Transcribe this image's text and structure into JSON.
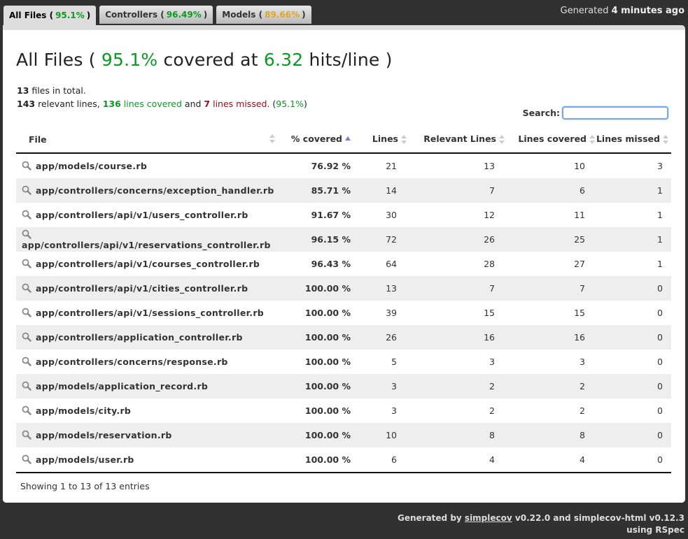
{
  "tabs": [
    {
      "label": "All Files",
      "pct": "95.1%",
      "color": "green",
      "active": true
    },
    {
      "label": "Controllers",
      "pct": "96.49%",
      "color": "green",
      "active": false
    },
    {
      "label": "Models",
      "pct": "89.66%",
      "color": "yellow",
      "active": false
    }
  ],
  "timestamp": {
    "prefix": "Generated",
    "value": "4 minutes ago"
  },
  "title": {
    "name": "All Files",
    "covered_pct": "95.1%",
    "covered_text": "covered at",
    "hits": "6.32",
    "hits_text": "hits/line"
  },
  "summary": {
    "files_count": "13",
    "files_text": "files in total.",
    "relevant": "143",
    "relevant_text": "relevant lines,",
    "covered": "136",
    "covered_text": "lines covered",
    "and_text": "and",
    "missed": "7",
    "missed_text": "lines missed.",
    "pct": "95.1%"
  },
  "search": {
    "label": "Search:",
    "value": "",
    "placeholder": ""
  },
  "table": {
    "headers": {
      "file": "File",
      "covered": "% covered",
      "lines": "Lines",
      "relevant": "Relevant Lines",
      "lines_covered": "Lines covered",
      "missed": "Lines missed"
    },
    "rows": [
      {
        "file": "app/models/course.rb",
        "covered": "76.92 %",
        "level": "red",
        "lines": "21",
        "relevant": "13",
        "lines_covered": "10",
        "missed": "3"
      },
      {
        "file": "app/controllers/concerns/exception_handler.rb",
        "covered": "85.71 %",
        "level": "yellow",
        "lines": "14",
        "relevant": "7",
        "lines_covered": "6",
        "missed": "1"
      },
      {
        "file": "app/controllers/api/v1/users_controller.rb",
        "covered": "91.67 %",
        "level": "green",
        "lines": "30",
        "relevant": "12",
        "lines_covered": "11",
        "missed": "1"
      },
      {
        "file": "app/controllers/api/v1/reservations_controller.rb",
        "covered": "96.15 %",
        "level": "green",
        "lines": "72",
        "relevant": "26",
        "lines_covered": "25",
        "missed": "1"
      },
      {
        "file": "app/controllers/api/v1/courses_controller.rb",
        "covered": "96.43 %",
        "level": "green",
        "lines": "64",
        "relevant": "28",
        "lines_covered": "27",
        "missed": "1"
      },
      {
        "file": "app/controllers/api/v1/cities_controller.rb",
        "covered": "100.00 %",
        "level": "green",
        "lines": "13",
        "relevant": "7",
        "lines_covered": "7",
        "missed": "0"
      },
      {
        "file": "app/controllers/api/v1/sessions_controller.rb",
        "covered": "100.00 %",
        "level": "green",
        "lines": "39",
        "relevant": "15",
        "lines_covered": "15",
        "missed": "0"
      },
      {
        "file": "app/controllers/application_controller.rb",
        "covered": "100.00 %",
        "level": "green",
        "lines": "26",
        "relevant": "16",
        "lines_covered": "16",
        "missed": "0"
      },
      {
        "file": "app/controllers/concerns/response.rb",
        "covered": "100.00 %",
        "level": "green",
        "lines": "5",
        "relevant": "3",
        "lines_covered": "3",
        "missed": "0"
      },
      {
        "file": "app/models/application_record.rb",
        "covered": "100.00 %",
        "level": "green",
        "lines": "3",
        "relevant": "2",
        "lines_covered": "2",
        "missed": "0"
      },
      {
        "file": "app/models/city.rb",
        "covered": "100.00 %",
        "level": "green",
        "lines": "3",
        "relevant": "2",
        "lines_covered": "2",
        "missed": "0"
      },
      {
        "file": "app/models/reservation.rb",
        "covered": "100.00 %",
        "level": "green",
        "lines": "10",
        "relevant": "8",
        "lines_covered": "8",
        "missed": "0"
      },
      {
        "file": "app/models/user.rb",
        "covered": "100.00 %",
        "level": "green",
        "lines": "6",
        "relevant": "4",
        "lines_covered": "4",
        "missed": "0"
      }
    ]
  },
  "info": "Showing 1 to 13 of 13 entries",
  "footer": {
    "prefix": "Generated by",
    "link": "simplecov",
    "middle": "v0.22.0 and simplecov-html v0.12.3",
    "line2": "using RSpec"
  },
  "colors": {
    "green": "#0a9b22",
    "yellow": "#e2a522",
    "red": "#a00d16",
    "background": "#313131",
    "sort_active": "#7b7be0"
  }
}
